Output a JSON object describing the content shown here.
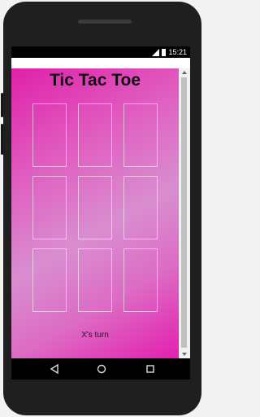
{
  "status_bar": {
    "time": "15:21",
    "signal_icon": "signal-icon",
    "battery_icon": "battery-icon"
  },
  "game": {
    "title": "Tic Tac Toe",
    "board": [
      "",
      "",
      "",
      "",
      "",
      "",
      "",
      "",
      ""
    ],
    "turn_text": "X's turn"
  },
  "nav_bar": {
    "back_icon": "back-icon",
    "home_icon": "home-icon",
    "recents_icon": "recents-icon"
  },
  "colors": {
    "gradient_pink": "#e020aa",
    "gradient_light": "#d98ed0",
    "phone_body": "#1f1f1f"
  }
}
